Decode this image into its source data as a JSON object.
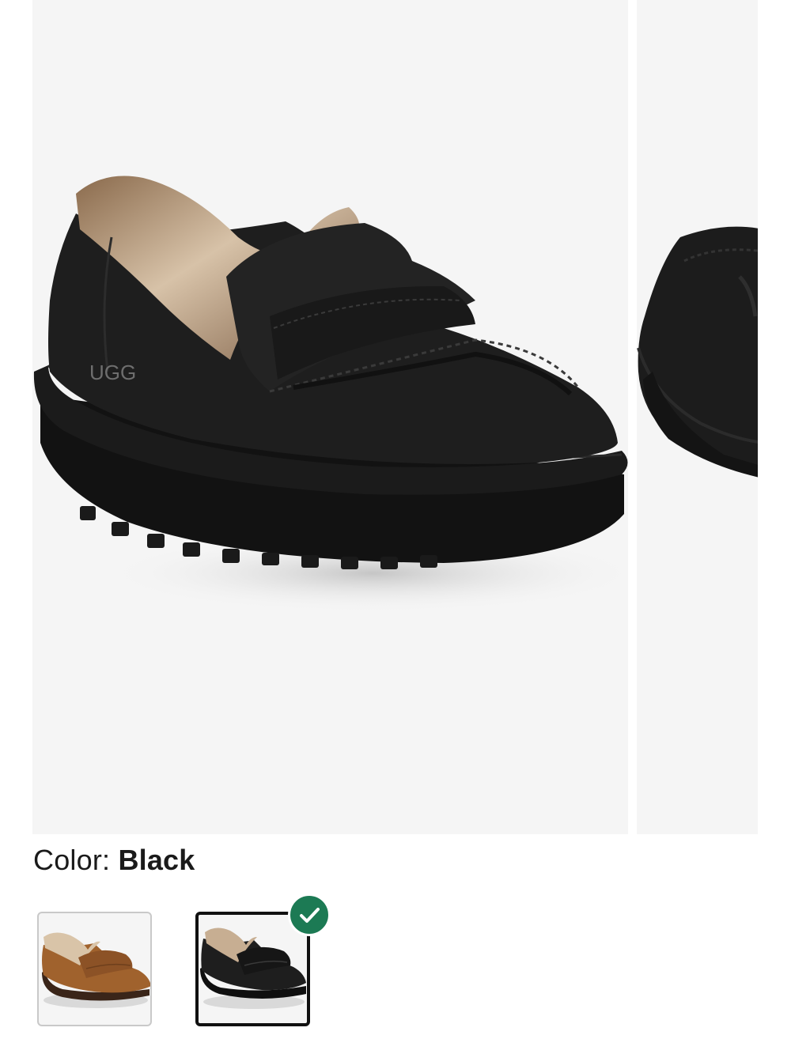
{
  "product_images": [
    {
      "alt": "UGG loafer with shearling lining, black, front three-quarter view"
    },
    {
      "alt": "UGG loafer, black, alternate angle view"
    }
  ],
  "color_selector": {
    "label": "Color:",
    "selected_value": "Black",
    "options": [
      {
        "name": "Chestnut",
        "selected": false,
        "swatch_color": "#a0622d"
      },
      {
        "name": "Black",
        "selected": true,
        "swatch_color": "#1c1c1c"
      }
    ],
    "selected_badge_color": "#1c7a54"
  },
  "colors": {
    "image_background": "#f5f5f5",
    "swatch_border": "#c9c9c9",
    "selected_border": "#111111"
  },
  "icons": {
    "selected_check": "checkmark-icon",
    "brand_mark": "ugg-logo"
  }
}
